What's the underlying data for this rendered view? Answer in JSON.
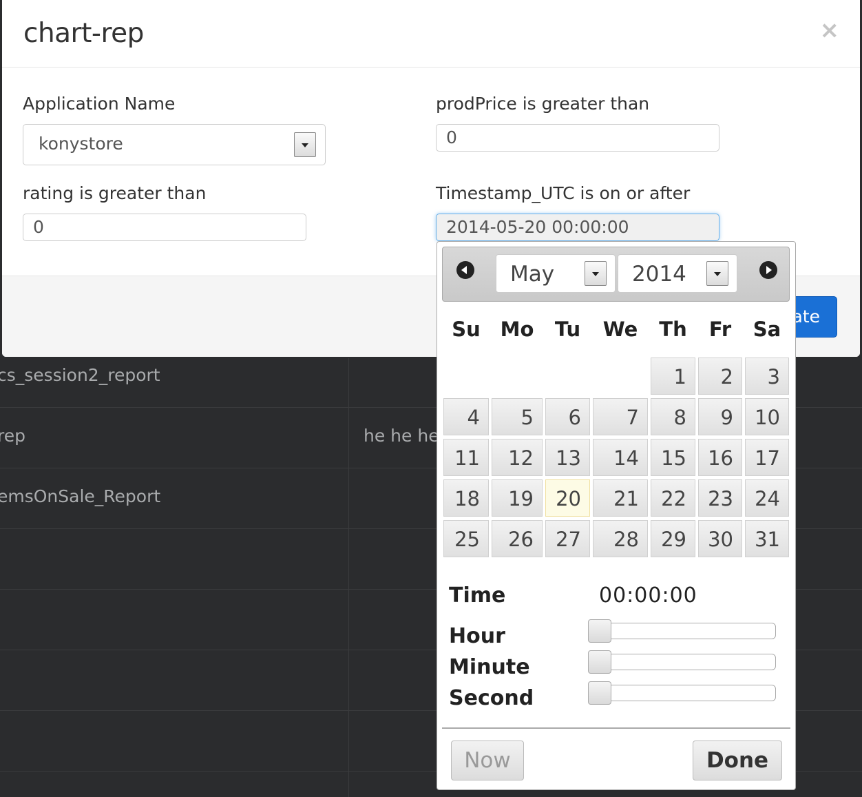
{
  "background_table": {
    "rows": [
      {
        "name": "cs_session2_report",
        "desc": ""
      },
      {
        "name": "rep",
        "desc": "he he he"
      },
      {
        "name": "emsOnSale_Report",
        "desc": ""
      },
      {
        "name": "",
        "desc": ""
      },
      {
        "name": "",
        "desc": ""
      },
      {
        "name": "",
        "desc": ""
      },
      {
        "name": "",
        "desc": ""
      }
    ]
  },
  "modal": {
    "title": "chart-rep",
    "close_label": "×",
    "fields": {
      "app_name_label": "Application Name",
      "app_name_value": "konystore",
      "prodprice_label": "prodPrice is greater than",
      "prodprice_value": "0",
      "rating_label": "rating is greater than",
      "rating_value": "0",
      "timestamp_label": "Timestamp_UTC is on or after",
      "timestamp_value": "2014-05-20 00:00:00"
    },
    "footer": {
      "primary_button_label": "ate"
    },
    "colors": {
      "primary": "#1a70d6",
      "focus": "#66afe9"
    }
  },
  "datepicker": {
    "month": "May",
    "year": "2014",
    "weekdays": [
      "Su",
      "Mo",
      "Tu",
      "We",
      "Th",
      "Fr",
      "Sa"
    ],
    "days": [
      "1",
      "2",
      "3",
      "4",
      "5",
      "6",
      "7",
      "8",
      "9",
      "10",
      "11",
      "12",
      "13",
      "14",
      "15",
      "16",
      "17",
      "18",
      "19",
      "20",
      "21",
      "22",
      "23",
      "24",
      "25",
      "26",
      "27",
      "28",
      "29",
      "30",
      "31"
    ],
    "first_weekday_index": 4,
    "selected_day": "20",
    "time_label": "Time",
    "time_value": "00:00:00",
    "hour_label": "Hour",
    "minute_label": "Minute",
    "second_label": "Second",
    "hour_value": 0,
    "minute_value": 0,
    "second_value": 0,
    "now_label": "Now",
    "done_label": "Done",
    "prev_icon": "arrow-left-circle-icon",
    "next_icon": "arrow-right-circle-icon"
  }
}
